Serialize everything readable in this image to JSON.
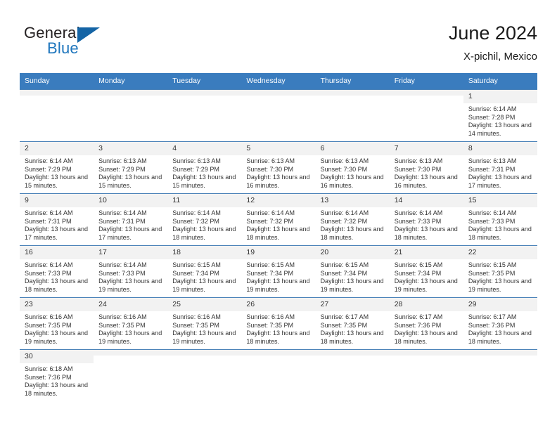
{
  "brand": {
    "word1": "General",
    "word2": "Blue",
    "logo_icon": "triangle-flag-icon"
  },
  "header": {
    "month_title": "June 2024",
    "location": "X-pichil, Mexico"
  },
  "calendar": {
    "weekday_headers": [
      "Sunday",
      "Monday",
      "Tuesday",
      "Wednesday",
      "Thursday",
      "Friday",
      "Saturday"
    ],
    "weeks": [
      [
        {
          "day": "",
          "blank": true
        },
        {
          "day": "",
          "blank": true
        },
        {
          "day": "",
          "blank": true
        },
        {
          "day": "",
          "blank": true
        },
        {
          "day": "",
          "blank": true
        },
        {
          "day": "",
          "blank": true
        },
        {
          "day": "1",
          "sunrise": "Sunrise: 6:14 AM",
          "sunset": "Sunset: 7:28 PM",
          "daylight": "Daylight: 13 hours and 14 minutes."
        }
      ],
      [
        {
          "day": "2",
          "sunrise": "Sunrise: 6:14 AM",
          "sunset": "Sunset: 7:29 PM",
          "daylight": "Daylight: 13 hours and 15 minutes."
        },
        {
          "day": "3",
          "sunrise": "Sunrise: 6:13 AM",
          "sunset": "Sunset: 7:29 PM",
          "daylight": "Daylight: 13 hours and 15 minutes."
        },
        {
          "day": "4",
          "sunrise": "Sunrise: 6:13 AM",
          "sunset": "Sunset: 7:29 PM",
          "daylight": "Daylight: 13 hours and 15 minutes."
        },
        {
          "day": "5",
          "sunrise": "Sunrise: 6:13 AM",
          "sunset": "Sunset: 7:30 PM",
          "daylight": "Daylight: 13 hours and 16 minutes."
        },
        {
          "day": "6",
          "sunrise": "Sunrise: 6:13 AM",
          "sunset": "Sunset: 7:30 PM",
          "daylight": "Daylight: 13 hours and 16 minutes."
        },
        {
          "day": "7",
          "sunrise": "Sunrise: 6:13 AM",
          "sunset": "Sunset: 7:30 PM",
          "daylight": "Daylight: 13 hours and 16 minutes."
        },
        {
          "day": "8",
          "sunrise": "Sunrise: 6:13 AM",
          "sunset": "Sunset: 7:31 PM",
          "daylight": "Daylight: 13 hours and 17 minutes."
        }
      ],
      [
        {
          "day": "9",
          "sunrise": "Sunrise: 6:14 AM",
          "sunset": "Sunset: 7:31 PM",
          "daylight": "Daylight: 13 hours and 17 minutes."
        },
        {
          "day": "10",
          "sunrise": "Sunrise: 6:14 AM",
          "sunset": "Sunset: 7:31 PM",
          "daylight": "Daylight: 13 hours and 17 minutes."
        },
        {
          "day": "11",
          "sunrise": "Sunrise: 6:14 AM",
          "sunset": "Sunset: 7:32 PM",
          "daylight": "Daylight: 13 hours and 18 minutes."
        },
        {
          "day": "12",
          "sunrise": "Sunrise: 6:14 AM",
          "sunset": "Sunset: 7:32 PM",
          "daylight": "Daylight: 13 hours and 18 minutes."
        },
        {
          "day": "13",
          "sunrise": "Sunrise: 6:14 AM",
          "sunset": "Sunset: 7:32 PM",
          "daylight": "Daylight: 13 hours and 18 minutes."
        },
        {
          "day": "14",
          "sunrise": "Sunrise: 6:14 AM",
          "sunset": "Sunset: 7:33 PM",
          "daylight": "Daylight: 13 hours and 18 minutes."
        },
        {
          "day": "15",
          "sunrise": "Sunrise: 6:14 AM",
          "sunset": "Sunset: 7:33 PM",
          "daylight": "Daylight: 13 hours and 18 minutes."
        }
      ],
      [
        {
          "day": "16",
          "sunrise": "Sunrise: 6:14 AM",
          "sunset": "Sunset: 7:33 PM",
          "daylight": "Daylight: 13 hours and 18 minutes."
        },
        {
          "day": "17",
          "sunrise": "Sunrise: 6:14 AM",
          "sunset": "Sunset: 7:33 PM",
          "daylight": "Daylight: 13 hours and 19 minutes."
        },
        {
          "day": "18",
          "sunrise": "Sunrise: 6:15 AM",
          "sunset": "Sunset: 7:34 PM",
          "daylight": "Daylight: 13 hours and 19 minutes."
        },
        {
          "day": "19",
          "sunrise": "Sunrise: 6:15 AM",
          "sunset": "Sunset: 7:34 PM",
          "daylight": "Daylight: 13 hours and 19 minutes."
        },
        {
          "day": "20",
          "sunrise": "Sunrise: 6:15 AM",
          "sunset": "Sunset: 7:34 PM",
          "daylight": "Daylight: 13 hours and 19 minutes."
        },
        {
          "day": "21",
          "sunrise": "Sunrise: 6:15 AM",
          "sunset": "Sunset: 7:34 PM",
          "daylight": "Daylight: 13 hours and 19 minutes."
        },
        {
          "day": "22",
          "sunrise": "Sunrise: 6:15 AM",
          "sunset": "Sunset: 7:35 PM",
          "daylight": "Daylight: 13 hours and 19 minutes."
        }
      ],
      [
        {
          "day": "23",
          "sunrise": "Sunrise: 6:16 AM",
          "sunset": "Sunset: 7:35 PM",
          "daylight": "Daylight: 13 hours and 19 minutes."
        },
        {
          "day": "24",
          "sunrise": "Sunrise: 6:16 AM",
          "sunset": "Sunset: 7:35 PM",
          "daylight": "Daylight: 13 hours and 19 minutes."
        },
        {
          "day": "25",
          "sunrise": "Sunrise: 6:16 AM",
          "sunset": "Sunset: 7:35 PM",
          "daylight": "Daylight: 13 hours and 19 minutes."
        },
        {
          "day": "26",
          "sunrise": "Sunrise: 6:16 AM",
          "sunset": "Sunset: 7:35 PM",
          "daylight": "Daylight: 13 hours and 18 minutes."
        },
        {
          "day": "27",
          "sunrise": "Sunrise: 6:17 AM",
          "sunset": "Sunset: 7:35 PM",
          "daylight": "Daylight: 13 hours and 18 minutes."
        },
        {
          "day": "28",
          "sunrise": "Sunrise: 6:17 AM",
          "sunset": "Sunset: 7:36 PM",
          "daylight": "Daylight: 13 hours and 18 minutes."
        },
        {
          "day": "29",
          "sunrise": "Sunrise: 6:17 AM",
          "sunset": "Sunset: 7:36 PM",
          "daylight": "Daylight: 13 hours and 18 minutes."
        }
      ],
      [
        {
          "day": "30",
          "sunrise": "Sunrise: 6:18 AM",
          "sunset": "Sunset: 7:36 PM",
          "daylight": "Daylight: 13 hours and 18 minutes."
        },
        {
          "day": "",
          "blank": true
        },
        {
          "day": "",
          "blank": true
        },
        {
          "day": "",
          "blank": true
        },
        {
          "day": "",
          "blank": true
        },
        {
          "day": "",
          "blank": true
        },
        {
          "day": "",
          "blank": true
        }
      ]
    ]
  },
  "colors": {
    "header_blue": "#3a7cbe",
    "brand_blue": "#1e76bd",
    "logo_blue": "#1464a5",
    "daynum_bg": "#f2f2f2",
    "text": "#333333"
  }
}
